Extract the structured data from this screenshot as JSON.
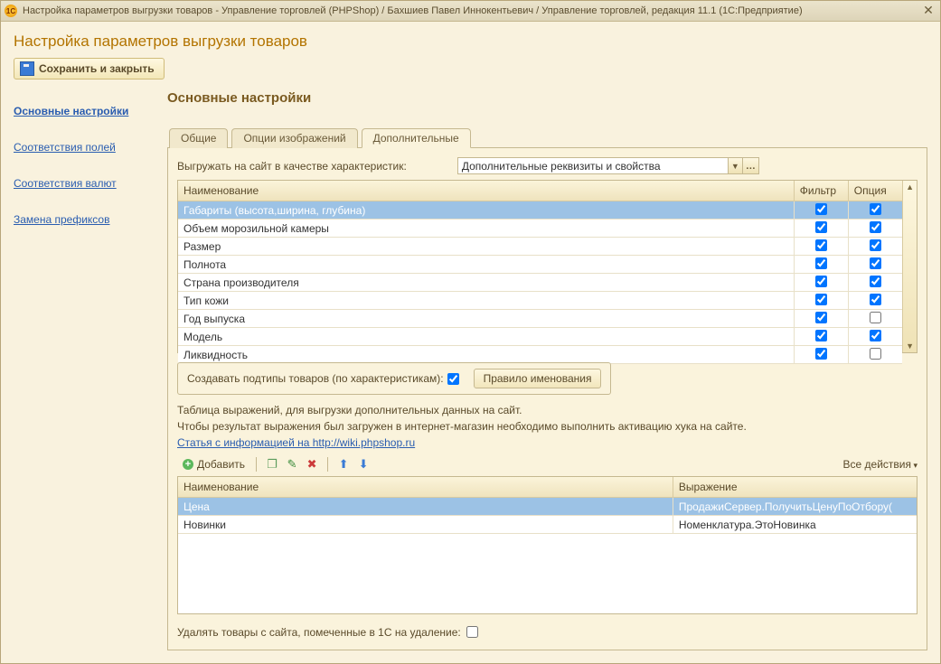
{
  "window": {
    "title": "Настройка параметров выгрузки товаров - Управление торговлей (PHPShop) / Бахшиев Павел Иннокентьевич / Управление торговлей, редакция 11.1  (1С:Предприятие)"
  },
  "page": {
    "title": "Настройка параметров выгрузки товаров",
    "save_close": "Сохранить и закрыть"
  },
  "sidebar": {
    "items": [
      {
        "label": "Основные настройки",
        "active": true
      },
      {
        "label": "Соответствия полей",
        "active": false
      },
      {
        "label": "Соответствия валют",
        "active": false
      },
      {
        "label": "Замена префиксов",
        "active": false
      }
    ]
  },
  "main": {
    "section_title": "Основные настройки",
    "tabs": [
      {
        "label": "Общие"
      },
      {
        "label": "Опции изображений"
      },
      {
        "label": "Дополнительные"
      }
    ],
    "active_tab": 2
  },
  "form": {
    "export_as_char_label": "Выгружать на сайт в качестве характеристик:",
    "export_as_char_value": "Дополнительные реквизиты и свойства"
  },
  "grid1": {
    "columns": [
      "Наименование",
      "Фильтр",
      "Опция"
    ],
    "rows": [
      {
        "name": "Габариты (высота,ширина, глубина)",
        "filter": true,
        "option": true,
        "selected": true
      },
      {
        "name": "Объем морозильной камеры",
        "filter": true,
        "option": true
      },
      {
        "name": "Размер",
        "filter": true,
        "option": true
      },
      {
        "name": "Полнота",
        "filter": true,
        "option": true
      },
      {
        "name": "Страна производителя",
        "filter": true,
        "option": true
      },
      {
        "name": "Тип кожи",
        "filter": true,
        "option": true
      },
      {
        "name": "Год выпуска",
        "filter": true,
        "option": false
      },
      {
        "name": "Модель",
        "filter": true,
        "option": true
      },
      {
        "name": "Ликвидность",
        "filter": true,
        "option": false
      }
    ]
  },
  "subtypes": {
    "label": "Создавать подтипы товаров (по характеристикам):",
    "checked": true,
    "naming_rule": "Правило именования"
  },
  "info": {
    "line1": "Таблица выражений, для выгрузки дополнительных данных на сайт.",
    "line2": "Чтобы результат выражения был загружен в интернет-магазин необходимо выполнить активацию хука на сайте.",
    "link": "Статья с информацией на http://wiki.phpshop.ru"
  },
  "toolbar2": {
    "add": "Добавить",
    "all_actions": "Все действия"
  },
  "grid2": {
    "columns": [
      "Наименование",
      "Выражение"
    ],
    "rows": [
      {
        "name": "Цена",
        "expr": "ПродажиСервер.ПолучитьЦенуПоОтбору(",
        "selected": true
      },
      {
        "name": "Новинки",
        "expr": "Номенклатура.ЭтоНовинка"
      }
    ]
  },
  "bottom": {
    "delete_label": "Удалять товары с сайта, помеченные в 1С на удаление:",
    "checked": false
  }
}
